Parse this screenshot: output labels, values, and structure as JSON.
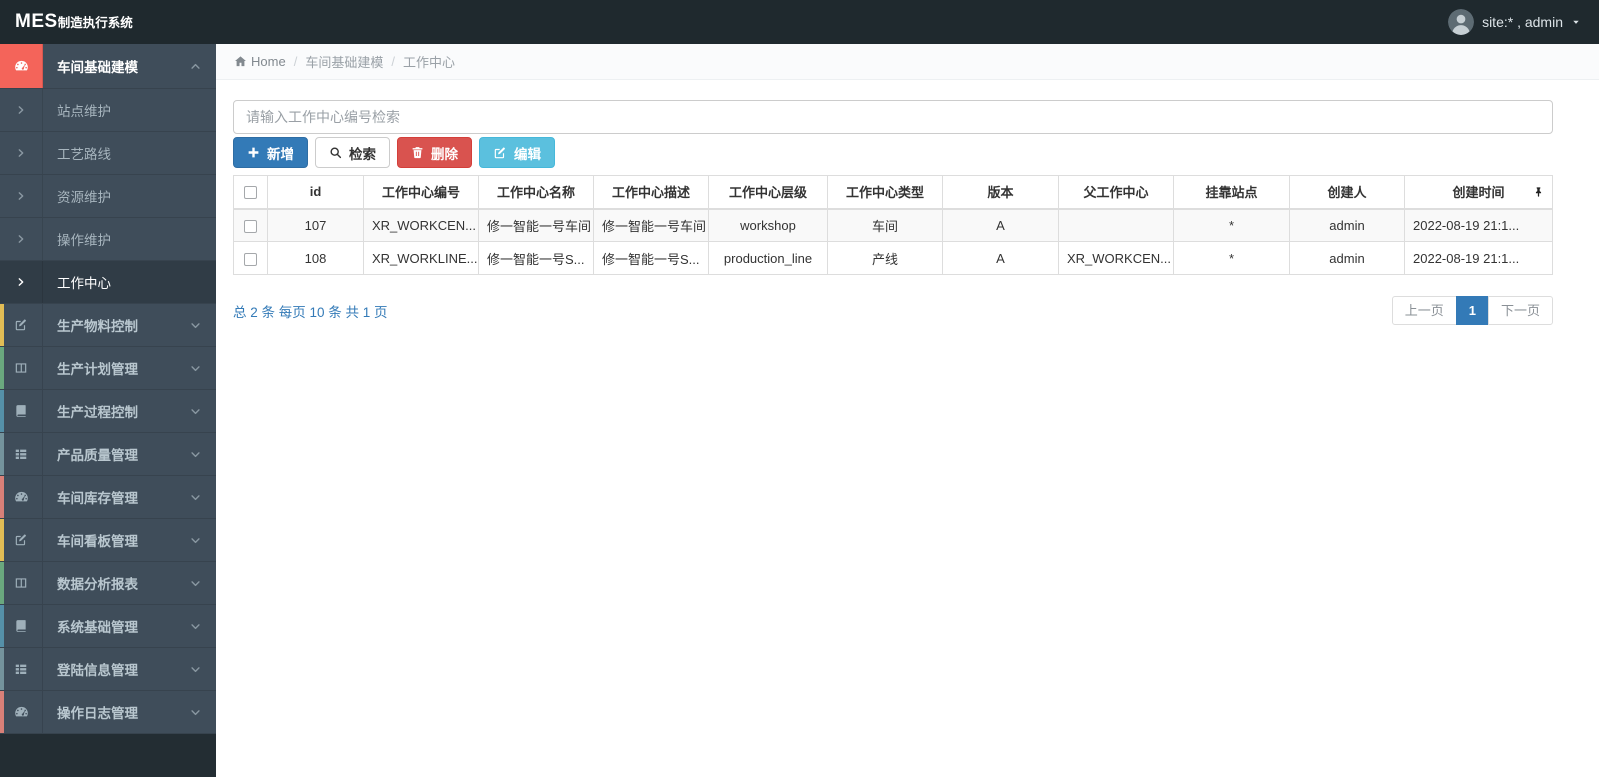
{
  "colors": {
    "primary": "#337ab7",
    "danger": "#d9534f",
    "info": "#5bc0de",
    "sidebar_active": "#f4645a"
  },
  "navbar": {
    "logo_bold": "MES",
    "logo_rest": "制造执行系统",
    "user": {
      "label": "site:* , admin",
      "avatar_icon": "user-avatar-icon",
      "caret_icon": "caret-down-icon"
    }
  },
  "sidebar": {
    "menu": [
      {
        "id": "workshop-modeling",
        "label": "车间基础建模",
        "icon": "gauge-icon",
        "accent": "#f4645a",
        "open": true,
        "children": [
          {
            "id": "station-maintenance",
            "label": "站点维护"
          },
          {
            "id": "process-route",
            "label": "工艺路线"
          },
          {
            "id": "resource-maintenance",
            "label": "资源维护"
          },
          {
            "id": "operation-maintenance",
            "label": "操作维护"
          },
          {
            "id": "work-center",
            "label": "工作中心",
            "active": true
          }
        ]
      },
      {
        "id": "material-control",
        "label": "生产物料控制",
        "icon": "edit-icon",
        "accent": "#e2bd55"
      },
      {
        "id": "plan-management",
        "label": "生产计划管理",
        "icon": "columns-icon",
        "accent": "#6aa87e"
      },
      {
        "id": "process-control",
        "label": "生产过程控制",
        "icon": "book-icon",
        "accent": "#5590a8"
      },
      {
        "id": "quality-management",
        "label": "产品质量管理",
        "icon": "list-icon",
        "accent": "#74939c"
      },
      {
        "id": "inventory-management",
        "label": "车间库存管理",
        "icon": "gauge-icon",
        "accent": "#d98078"
      },
      {
        "id": "board-management",
        "label": "车间看板管理",
        "icon": "edit-icon",
        "accent": "#e2bd55"
      },
      {
        "id": "data-analysis-report",
        "label": "数据分析报表",
        "icon": "columns-icon",
        "accent": "#6aa87e"
      },
      {
        "id": "system-basic-management",
        "label": "系统基础管理",
        "icon": "book-icon",
        "accent": "#5590a8"
      },
      {
        "id": "login-info-management",
        "label": "登陆信息管理",
        "icon": "list-icon",
        "accent": "#74939c"
      },
      {
        "id": "operation-log-management",
        "label": "操作日志管理",
        "icon": "gauge-icon",
        "accent": "#d98078"
      }
    ]
  },
  "breadcrumb": {
    "items": [
      {
        "id": "home",
        "label": "Home",
        "icon": "home-icon"
      },
      {
        "id": "workshop-modeling",
        "label": "车间基础建模"
      },
      {
        "id": "work-center",
        "label": "工作中心",
        "current": true
      }
    ]
  },
  "toolbar": {
    "search_placeholder": "请输入工作中心编号检索",
    "search_value": "",
    "buttons": [
      {
        "id": "add",
        "label": "新增",
        "icon": "plus-icon",
        "style": "primary"
      },
      {
        "id": "search",
        "label": "检索",
        "icon": "search-icon",
        "style": "default"
      },
      {
        "id": "delete",
        "label": "删除",
        "icon": "trash-icon",
        "style": "danger"
      },
      {
        "id": "edit",
        "label": "编辑",
        "icon": "edit-icon",
        "style": "info"
      }
    ]
  },
  "table": {
    "headers": [
      "id",
      "工作中心编号",
      "工作中心名称",
      "工作中心描述",
      "工作中心层级",
      "工作中心类型",
      "版本",
      "父工作中心",
      "挂靠站点",
      "创建人",
      "创建时间"
    ],
    "pin_icon": "pin-icon",
    "rows": [
      [
        "107",
        "XR_WORKCEN...",
        "修一智能一号车间",
        "修一智能一号车间",
        "workshop",
        "车间",
        "A",
        "",
        "*",
        "admin",
        "2022-08-19 21:1..."
      ],
      [
        "108",
        "XR_WORKLINE...",
        "修一智能一号S...",
        "修一智能一号S...",
        "production_line",
        "产线",
        "A",
        "XR_WORKCEN...",
        "*",
        "admin",
        "2022-08-19 21:1..."
      ]
    ]
  },
  "pagination": {
    "info": "总 2 条 每页 10 条 共 1 页",
    "prev_label": "上一页",
    "page": "1",
    "next_label": "下一页"
  }
}
